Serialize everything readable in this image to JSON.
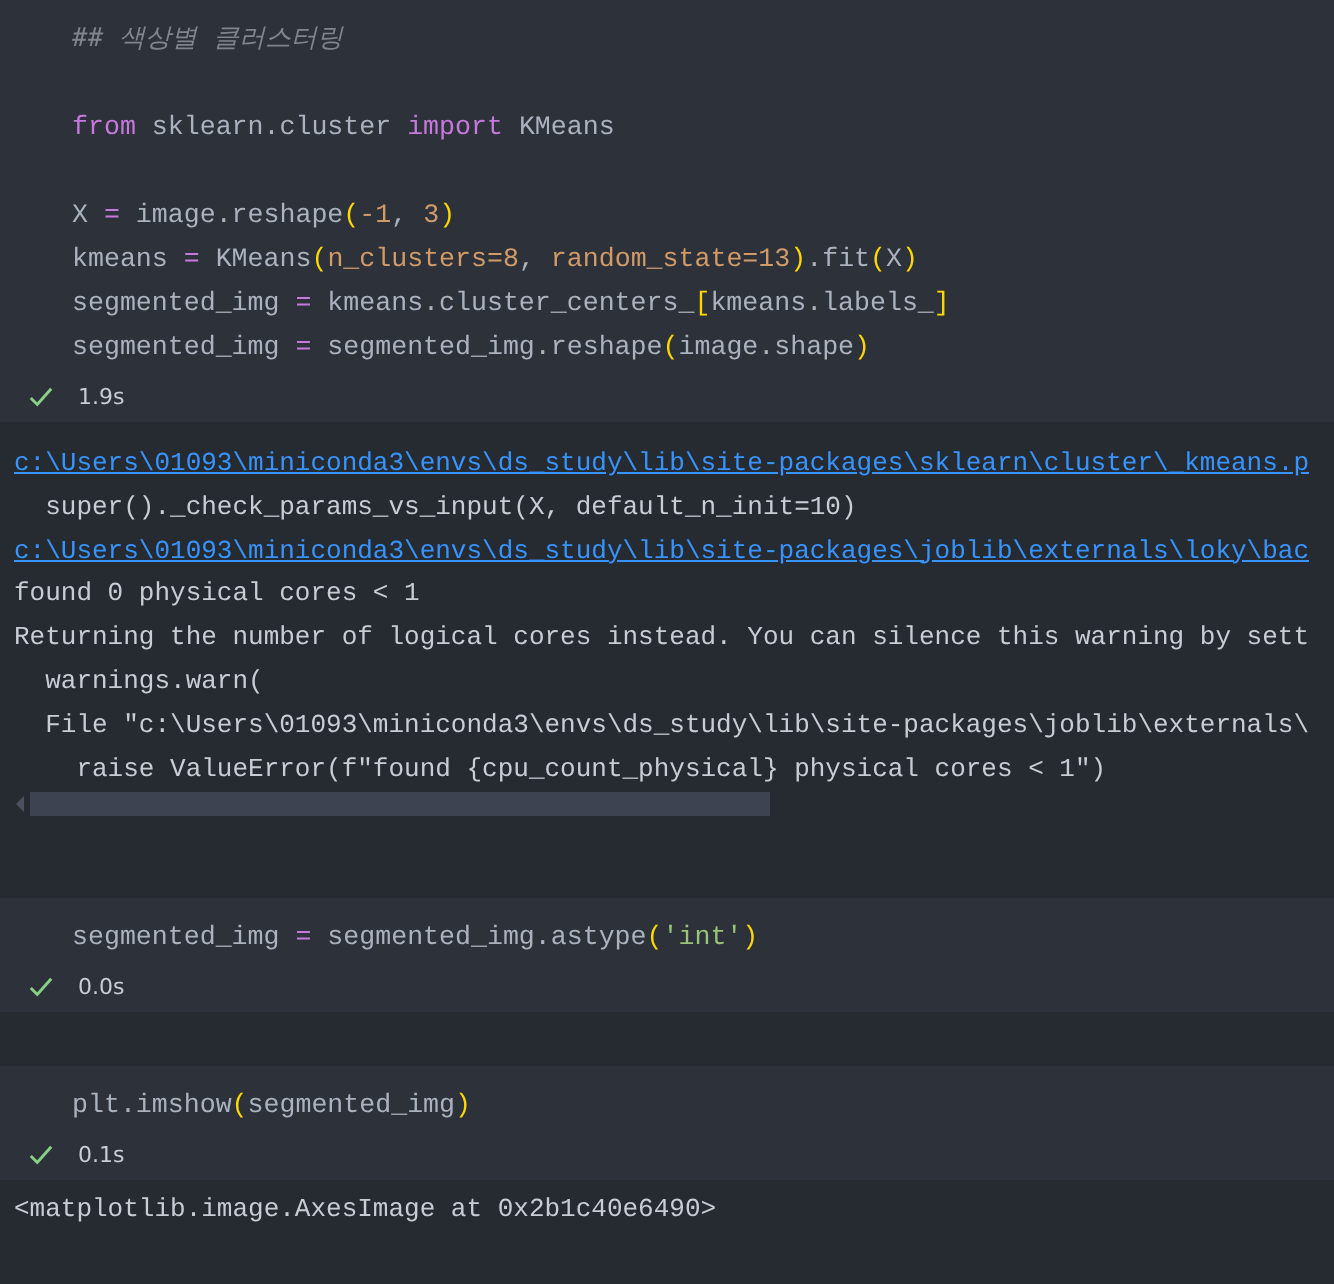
{
  "cells": [
    {
      "lines": [
        {
          "kind": "code",
          "tokens": [
            {
              "kind": "comment",
              "text": "## 색상별 클러스터링"
            }
          ]
        },
        {
          "kind": "blank"
        },
        {
          "kind": "code",
          "tokens": [
            {
              "kind": "keyword",
              "text": "from"
            },
            {
              "kind": "plain",
              "text": " sklearn.cluster "
            },
            {
              "kind": "keyword",
              "text": "import"
            },
            {
              "kind": "plain",
              "text": " KMeans"
            }
          ]
        },
        {
          "kind": "blank"
        },
        {
          "kind": "code",
          "tokens": [
            {
              "kind": "plain",
              "text": "X "
            },
            {
              "kind": "op",
              "text": "="
            },
            {
              "kind": "plain",
              "text": " image.reshape"
            },
            {
              "kind": "paren",
              "text": "("
            },
            {
              "kind": "number",
              "text": "-1"
            },
            {
              "kind": "plain",
              "text": ", "
            },
            {
              "kind": "number",
              "text": "3"
            },
            {
              "kind": "paren",
              "text": ")"
            }
          ]
        },
        {
          "kind": "code",
          "tokens": [
            {
              "kind": "plain",
              "text": "kmeans "
            },
            {
              "kind": "op",
              "text": "="
            },
            {
              "kind": "plain",
              "text": " KMeans"
            },
            {
              "kind": "paren",
              "text": "("
            },
            {
              "kind": "param",
              "text": "n_clusters=8"
            },
            {
              "kind": "plain",
              "text": ", "
            },
            {
              "kind": "param",
              "text": "random_state=13"
            },
            {
              "kind": "paren",
              "text": ")"
            },
            {
              "kind": "plain",
              "text": ".fit"
            },
            {
              "kind": "paren",
              "text": "("
            },
            {
              "kind": "plain",
              "text": "X"
            },
            {
              "kind": "paren",
              "text": ")"
            }
          ]
        },
        {
          "kind": "code",
          "tokens": [
            {
              "kind": "plain",
              "text": "segmented_img "
            },
            {
              "kind": "op",
              "text": "="
            },
            {
              "kind": "plain",
              "text": " kmeans.cluster_centers_"
            },
            {
              "kind": "paren",
              "text": "["
            },
            {
              "kind": "plain",
              "text": "kmeans.labels_"
            },
            {
              "kind": "paren",
              "text": "]"
            }
          ]
        },
        {
          "kind": "code",
          "tokens": [
            {
              "kind": "plain",
              "text": "segmented_img "
            },
            {
              "kind": "op",
              "text": "="
            },
            {
              "kind": "plain",
              "text": " segmented_img.reshape"
            },
            {
              "kind": "paren",
              "text": "("
            },
            {
              "kind": "plain",
              "text": "image.shape"
            },
            {
              "kind": "paren",
              "text": ")"
            }
          ]
        }
      ],
      "succeeded": true,
      "duration": "1.9s",
      "output": {
        "scrollable": true,
        "lines": [
          {
            "kind": "link",
            "text": "c:\\Users\\01093\\miniconda3\\envs\\ds_study\\lib\\site-packages\\sklearn\\cluster\\_kmeans.p"
          },
          {
            "kind": "text",
            "text": "  super()._check_params_vs_input(X, default_n_init=10)"
          },
          {
            "kind": "link",
            "text": "c:\\Users\\01093\\miniconda3\\envs\\ds_study\\lib\\site-packages\\joblib\\externals\\loky\\bac"
          },
          {
            "kind": "text",
            "text": "found 0 physical cores < 1"
          },
          {
            "kind": "text",
            "text": "Returning the number of logical cores instead. You can silence this warning by sett"
          },
          {
            "kind": "text",
            "text": "  warnings.warn("
          },
          {
            "kind": "text",
            "text": "  File \"c:\\Users\\01093\\miniconda3\\envs\\ds_study\\lib\\site-packages\\joblib\\externals\\"
          },
          {
            "kind": "text",
            "text": "    raise ValueError(f\"found {cpu_count_physical} physical cores < 1\")"
          }
        ]
      }
    },
    {
      "lines": [
        {
          "kind": "code",
          "tokens": [
            {
              "kind": "plain",
              "text": "segmented_img "
            },
            {
              "kind": "op",
              "text": "="
            },
            {
              "kind": "plain",
              "text": " segmented_img.astype"
            },
            {
              "kind": "paren",
              "text": "("
            },
            {
              "kind": "string",
              "text": "'int'"
            },
            {
              "kind": "paren",
              "text": ")"
            }
          ]
        }
      ],
      "succeeded": true,
      "duration": "0.0s"
    },
    {
      "lines": [
        {
          "kind": "code",
          "tokens": [
            {
              "kind": "plain",
              "text": "plt.imshow"
            },
            {
              "kind": "paren",
              "text": "("
            },
            {
              "kind": "plain",
              "text": "segmented_img"
            },
            {
              "kind": "paren",
              "text": ")"
            }
          ]
        }
      ],
      "succeeded": true,
      "duration": "0.1s",
      "output": {
        "scrollable": false,
        "lines": [
          {
            "kind": "text",
            "text": "<matplotlib.image.AxesImage at 0x2b1c40e6490>"
          }
        ]
      }
    }
  ]
}
